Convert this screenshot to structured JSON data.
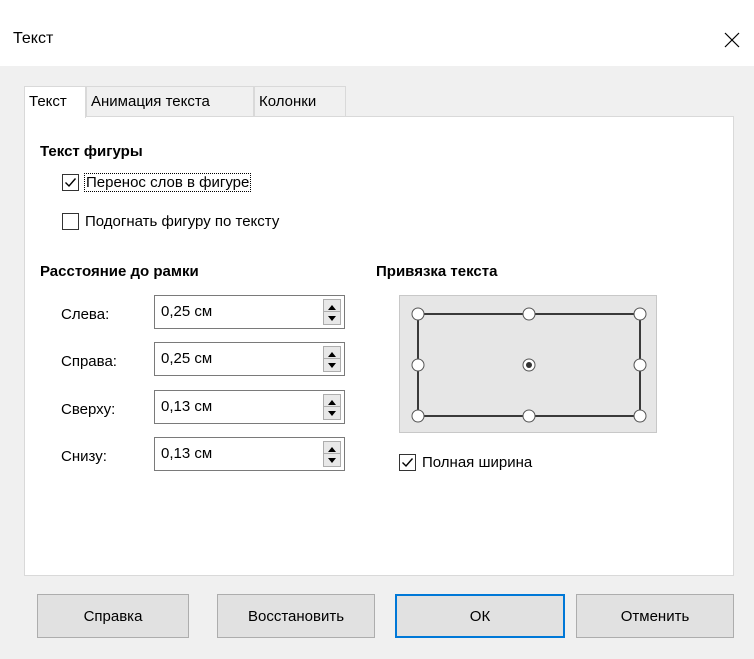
{
  "window": {
    "title": "Текст"
  },
  "tabs": [
    {
      "label": "Текст",
      "active": true
    },
    {
      "label": "Анимация текста",
      "active": false
    },
    {
      "label": "Колонки",
      "active": false
    }
  ],
  "shape_text": {
    "title": "Текст фигуры",
    "word_wrap": {
      "label": "Перенос слов в фигуре",
      "checked": true
    },
    "fit_shape": {
      "label": "Подогнать фигуру по тексту",
      "checked": false
    }
  },
  "spacing": {
    "title": "Расстояние до рамки",
    "left": {
      "label": "Слева:",
      "value": "0,25 см"
    },
    "right": {
      "label": "Справа:",
      "value": "0,25 см"
    },
    "top": {
      "label": "Сверху:",
      "value": "0,13 см"
    },
    "bottom": {
      "label": "Снизу:",
      "value": "0,13 см"
    }
  },
  "anchor": {
    "title": "Привязка текста",
    "selected": "center",
    "full_width": {
      "label": "Полная ширина",
      "checked": true
    }
  },
  "buttons": {
    "help": "Справка",
    "reset": "Восстановить",
    "ok": "ОК",
    "cancel": "Отменить"
  },
  "colors": {
    "default_button_border": "#0078d7",
    "panel_bg": "#ffffff",
    "dialog_bg": "#f0f0f0"
  }
}
